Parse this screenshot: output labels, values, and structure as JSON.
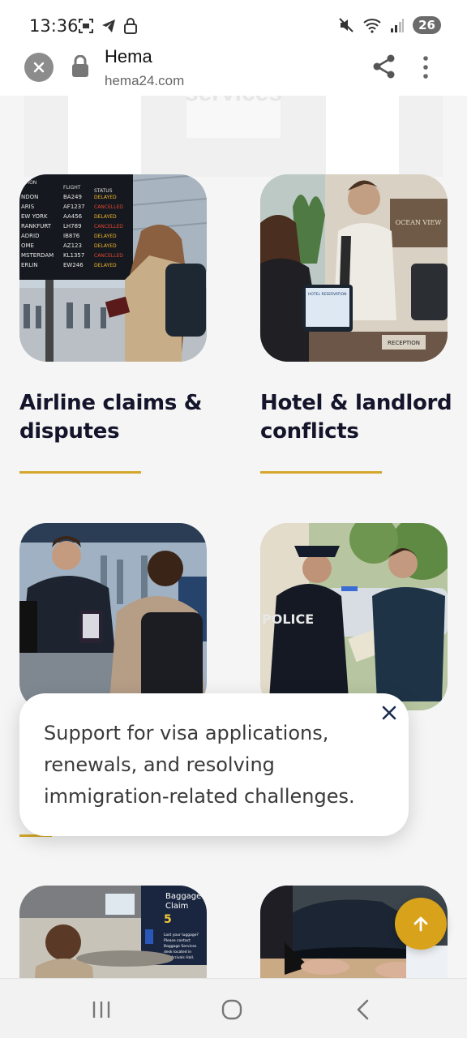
{
  "status_bar": {
    "time": "13:36",
    "battery": "26"
  },
  "browser": {
    "title": "Hema",
    "url": "hema24.com"
  },
  "background_peek_text": "services",
  "cards": [
    {
      "title_line1": "Airline claims &",
      "title_line2": "disputes",
      "image": "airport-departure-board-photo"
    },
    {
      "title_line1": "Hotel & landlord",
      "title_line2": "conflicts",
      "image": "hotel-reception-photo"
    },
    {
      "image": "passport-control-photo"
    },
    {
      "image": "police-officer-photo"
    },
    {
      "image": "baggage-claim-photo"
    },
    {
      "image": "car-rental-photo"
    }
  ],
  "board": {
    "headers": [
      "ATION",
      "FLIGHT",
      "STATUS"
    ],
    "rows": [
      [
        "NDON",
        "BA249",
        "DELAYED"
      ],
      [
        "ARIS",
        "AF1237",
        "CANCELLED"
      ],
      [
        "EW YORK",
        "AA456",
        "DELAYED"
      ],
      [
        "RANKFURT",
        "LH789",
        "CANCELLED"
      ],
      [
        "ADRID",
        "IB876",
        "DELAYED"
      ],
      [
        "OME",
        "AZ123",
        "DELAYED"
      ],
      [
        "MSTERDAM",
        "KL1357",
        "CANCELLED"
      ],
      [
        "ERLIN",
        "EW246",
        "DELAYED"
      ]
    ]
  },
  "photo_labels": {
    "hotel_sign": "OCEAN VIEW",
    "reception": "RECEPTION",
    "hotel_screen": "HOTEL RESERVATION",
    "police": "POLICE",
    "baggage_title_1": "Baggage",
    "baggage_title_2": "Claim",
    "baggage_number": "5",
    "baggage_lost_line1": "Lost your luggage?",
    "baggage_lost_line2": "Please contact",
    "baggage_lost_line3": "Baggage Services",
    "baggage_lost_line4": "desk located in",
    "baggage_lost_line5": "the Arrivals Hall."
  },
  "tooltip": {
    "text": "Support for visa applications, renewals, and resolving immigration-related challenges."
  },
  "colors": {
    "accent_gold": "#d4a72c",
    "fab": "#d9a21b",
    "title_text": "#14142b"
  }
}
